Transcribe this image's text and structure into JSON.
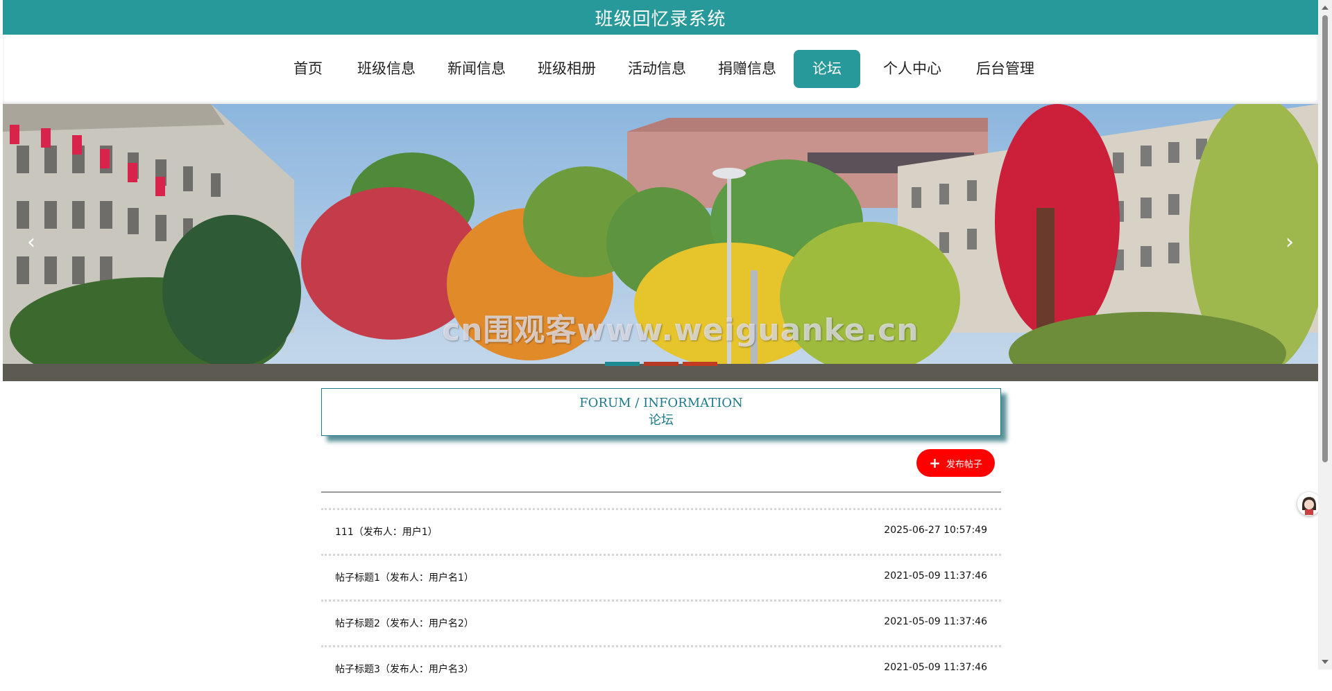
{
  "header": {
    "title": "班级回忆录系统"
  },
  "nav": {
    "items": [
      {
        "label": "首页"
      },
      {
        "label": "班级信息"
      },
      {
        "label": "新闻信息"
      },
      {
        "label": "班级相册"
      },
      {
        "label": "活动信息"
      },
      {
        "label": "捐赠信息"
      },
      {
        "label": "论坛",
        "active": true
      },
      {
        "label": "个人中心"
      },
      {
        "label": "后台管理"
      }
    ]
  },
  "banner": {
    "watermark": "cn围观客www.weiguanke.cn",
    "prev_icon": "chevron-left-icon",
    "next_icon": "chevron-right-icon",
    "slide_count": 3,
    "active_slide": 1
  },
  "section": {
    "title_en": "FORUM / INFORMATION",
    "title_cn": "论坛"
  },
  "add_button": {
    "label": "发布帖子",
    "icon": "plus-icon"
  },
  "posts": [
    {
      "title": "111（发布人：用户1）",
      "date": "2025-06-27 10:57:49"
    },
    {
      "title": "帖子标题1（发布人：用户名1）",
      "date": "2021-05-09 11:37:46"
    },
    {
      "title": "帖子标题2（发布人：用户名2）",
      "date": "2021-05-09 11:37:46"
    },
    {
      "title": "帖子标题3（发布人：用户名3）",
      "date": "2021-05-09 11:37:46"
    }
  ],
  "colors": {
    "accent": "#27999a",
    "add_button": "#ff0000",
    "title_text": "#1c7a86"
  }
}
